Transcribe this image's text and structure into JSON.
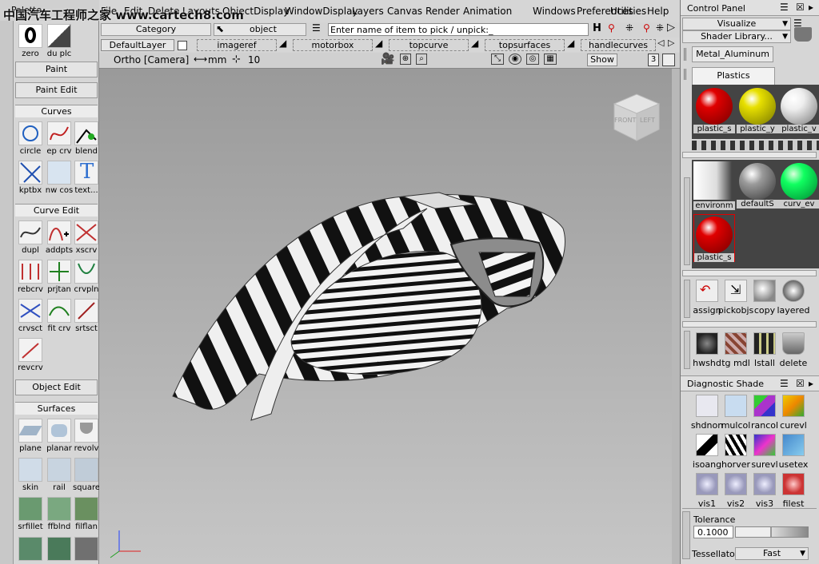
{
  "watermark": "中国汽车工程师之家 www.cartech8.com",
  "palette": {
    "title": "Palette",
    "top_tools": [
      {
        "label": "zero"
      },
      {
        "label": "du plc"
      }
    ],
    "paint_btn": "Paint",
    "paint_edit_btn": "Paint Edit",
    "curves_head": "Curves",
    "curves": [
      {
        "label": "circle"
      },
      {
        "label": "ep crv"
      },
      {
        "label": "blend"
      },
      {
        "label": "kptbx"
      },
      {
        "label": "nw cos"
      },
      {
        "label": "text..."
      }
    ],
    "curve_edit_head": "Curve Edit",
    "curve_edit": [
      {
        "label": "dupl"
      },
      {
        "label": "addpts"
      },
      {
        "label": "xscrv"
      },
      {
        "label": "rebcrv"
      },
      {
        "label": "prjtan"
      },
      {
        "label": "crvpln"
      },
      {
        "label": "crvsct"
      },
      {
        "label": "fit crv"
      },
      {
        "label": "srtsct"
      },
      {
        "label": "revcrv"
      }
    ],
    "object_edit_btn": "Object Edit",
    "surfaces_head": "Surfaces",
    "surfaces": [
      {
        "label": "plane"
      },
      {
        "label": "planar"
      },
      {
        "label": "revolv"
      },
      {
        "label": "skin"
      },
      {
        "label": "rail"
      },
      {
        "label": "square"
      },
      {
        "label": "srfillet"
      },
      {
        "label": "ffblnd"
      },
      {
        "label": "filflan"
      }
    ]
  },
  "menubar": {
    "file": "File",
    "items": [
      "Edit",
      "Delete",
      "Layouts",
      "ObjectDisplay",
      "WindowDisplay",
      "Layers",
      "Canvas",
      "Render",
      "Animation",
      "Windows",
      "Preferences",
      "Utilities",
      "Help"
    ]
  },
  "toolbar": {
    "category_label": "Category",
    "object_label": "object",
    "pick_placeholder": "Enter name of item to pick / unpick:_"
  },
  "layers": {
    "default": "DefaultLayer",
    "items": [
      "imageref",
      "motorbox",
      "topcurve",
      "topsurfaces",
      "handlecurves"
    ]
  },
  "viewport": {
    "camera": "Ortho [Camera]",
    "units": "mm",
    "grid_value": "10",
    "show_btn": "Show",
    "view_number": "3",
    "cube_front": "FRONT",
    "cube_left": "LEFT"
  },
  "control_panel": {
    "title": "Control Panel",
    "visualize": "Visualize",
    "shader_library": "Shader Library...",
    "tab_metal": "Metal_Aluminum",
    "tab_plastics": "Plastics",
    "plastics": [
      {
        "label": "plastic_s",
        "color": "#e00000"
      },
      {
        "label": "plastic_y",
        "color": "#e8e000"
      },
      {
        "label": "plastic_v",
        "color": "#f4f4f4"
      }
    ],
    "scene_shaders": [
      {
        "label": "environm",
        "color": "#f0f0f0"
      },
      {
        "label": "defaultS",
        "color": "#9a9a9a"
      },
      {
        "label": "curv_ev",
        "color": "#10ff60"
      },
      {
        "label": "plastic_s",
        "color": "#e00000"
      }
    ],
    "actions1": [
      {
        "label": "assign",
        "icon": "assign-icon"
      },
      {
        "label": "pickobjs",
        "icon": "pickobjs-icon"
      },
      {
        "label": "copy",
        "icon": "copy-icon"
      },
      {
        "label": "layered",
        "icon": "layered-icon"
      }
    ],
    "actions2": [
      {
        "label": "hwshd",
        "icon": "hwshd-icon"
      },
      {
        "label": "tg mdl",
        "icon": "tg-mdl-icon"
      },
      {
        "label": "lstall",
        "icon": "lstall-icon"
      },
      {
        "label": "delete",
        "icon": "delete-icon"
      }
    ],
    "diagnostic_title": "Diagnostic Shade",
    "diagnostic": [
      {
        "label": "shdnon"
      },
      {
        "label": "mulcol"
      },
      {
        "label": "rancol"
      },
      {
        "label": "curevl"
      },
      {
        "label": "isoang"
      },
      {
        "label": "horver"
      },
      {
        "label": "surevl"
      },
      {
        "label": "usetex"
      },
      {
        "label": "vis1"
      },
      {
        "label": "vis2"
      },
      {
        "label": "vis3"
      },
      {
        "label": "filest"
      }
    ],
    "tolerance_label": "Tolerance",
    "tolerance_value": "0.1000",
    "tessellator_label": "Tessellator",
    "tessellator_value": "Fast"
  }
}
